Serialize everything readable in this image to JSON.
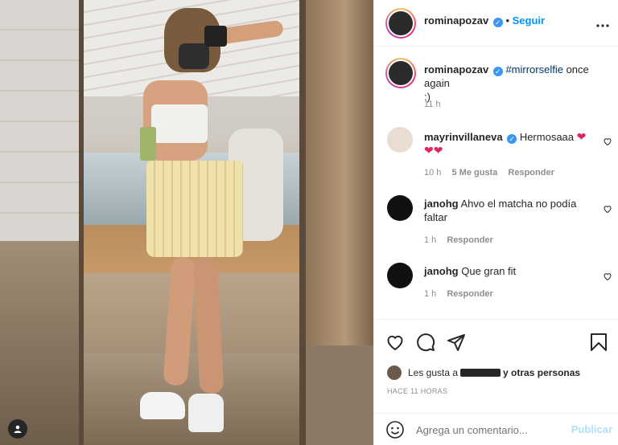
{
  "post": {
    "author": "rominapozav",
    "follow_label": "Seguir",
    "caption_hashtag": "#mirrorselfie",
    "caption_text": " once again",
    "caption_text_2": ":)",
    "caption_time": "11 h"
  },
  "comments": [
    {
      "user": "mayrinvillaneva",
      "verified": true,
      "text": "Hermosaaa",
      "emoji_line2": "❤❤",
      "time": "10 h",
      "likes": "5 Me gusta",
      "reply": "Responder"
    },
    {
      "user": "janohg",
      "verified": false,
      "text": "Ahvo el matcha no podía",
      "text_2": "faltar",
      "time": "1 h",
      "reply": "Responder"
    },
    {
      "user": "janohg",
      "verified": false,
      "text": "Que gran fit",
      "time": "1 h",
      "reply": "Responder"
    }
  ],
  "likes": {
    "prefix": "Les gusta a",
    "suffix": "y otras personas"
  },
  "time_ago": "HACE 11 HORAS",
  "comment_box": {
    "placeholder": "Agrega un comentario...",
    "publish_label": "Publicar"
  },
  "icons": [
    "more-icon",
    "verified-icon",
    "heart-icon",
    "comment-icon",
    "share-icon",
    "bookmark-icon",
    "emoji-icon",
    "tag-user-icon"
  ],
  "colors": {
    "link": "#0095f6",
    "publish_disabled": "#b2dffc",
    "verified": "#3897f0",
    "muted": "#8e8e8e",
    "heart": "#e0245e"
  }
}
